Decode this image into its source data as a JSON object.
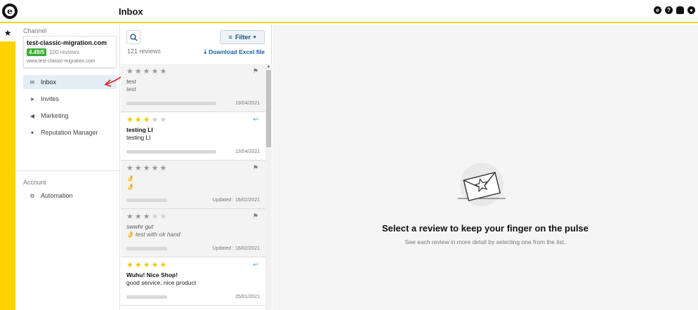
{
  "header": {
    "title": "Inbox"
  },
  "top_icons": [
    "account-icon",
    "help-icon",
    "bell-icon",
    "user-icon"
  ],
  "sidebar": {
    "channel_label": "Channel",
    "channel": {
      "name": "test-classic-migration.com",
      "rating": "4.49/5",
      "reviews": "100 reviews",
      "url": "www.test-classic-migration.com"
    },
    "items": [
      {
        "label": "Inbox",
        "icon": "inbox-icon",
        "active": true
      },
      {
        "label": "Invites",
        "icon": "send-icon"
      },
      {
        "label": "Marketing",
        "icon": "megaphone-icon"
      },
      {
        "label": "Reputation Manager",
        "icon": "sparkle-icon"
      }
    ],
    "account_label": "Account",
    "account_items": [
      {
        "label": "Automation",
        "icon": "robot-icon"
      }
    ]
  },
  "list": {
    "filter_label": "Filter",
    "review_count": "121 reviews",
    "download_label": "Download Excel file",
    "reviews": [
      {
        "rating": 0,
        "title": "test",
        "body": "test",
        "date": "19/04/2021",
        "action_icon": "flag-icon"
      },
      {
        "rating": 3,
        "title": "testing LI",
        "body": "testing LI",
        "date": "13/04/2021",
        "action_icon": "reply-icon"
      },
      {
        "rating": 0,
        "title": "👌",
        "body": "👌",
        "date": "Updated : 16/02/2021",
        "action_icon": "flag-icon"
      },
      {
        "rating": 3,
        "title": "swwhr gut",
        "body": "👌 test with ok hand",
        "date": "Updated : 16/02/2021",
        "action_icon": "flag-icon"
      },
      {
        "rating": 5,
        "title": "Wuhu! Nice Shop!",
        "body": "good service, nice product",
        "date": "25/01/2021",
        "action_icon": "reply-icon"
      }
    ]
  },
  "detail": {
    "title": "Select a review to keep your finger on the pulse",
    "subtitle": "See each review in more detail by selecting one from the list."
  },
  "colors": {
    "brand_yellow": "#ffd300",
    "rating_green": "#3aaa35",
    "link_blue": "#1b5fa0",
    "star_yellow": "#f3c800",
    "annotation_red": "#e0201c"
  }
}
